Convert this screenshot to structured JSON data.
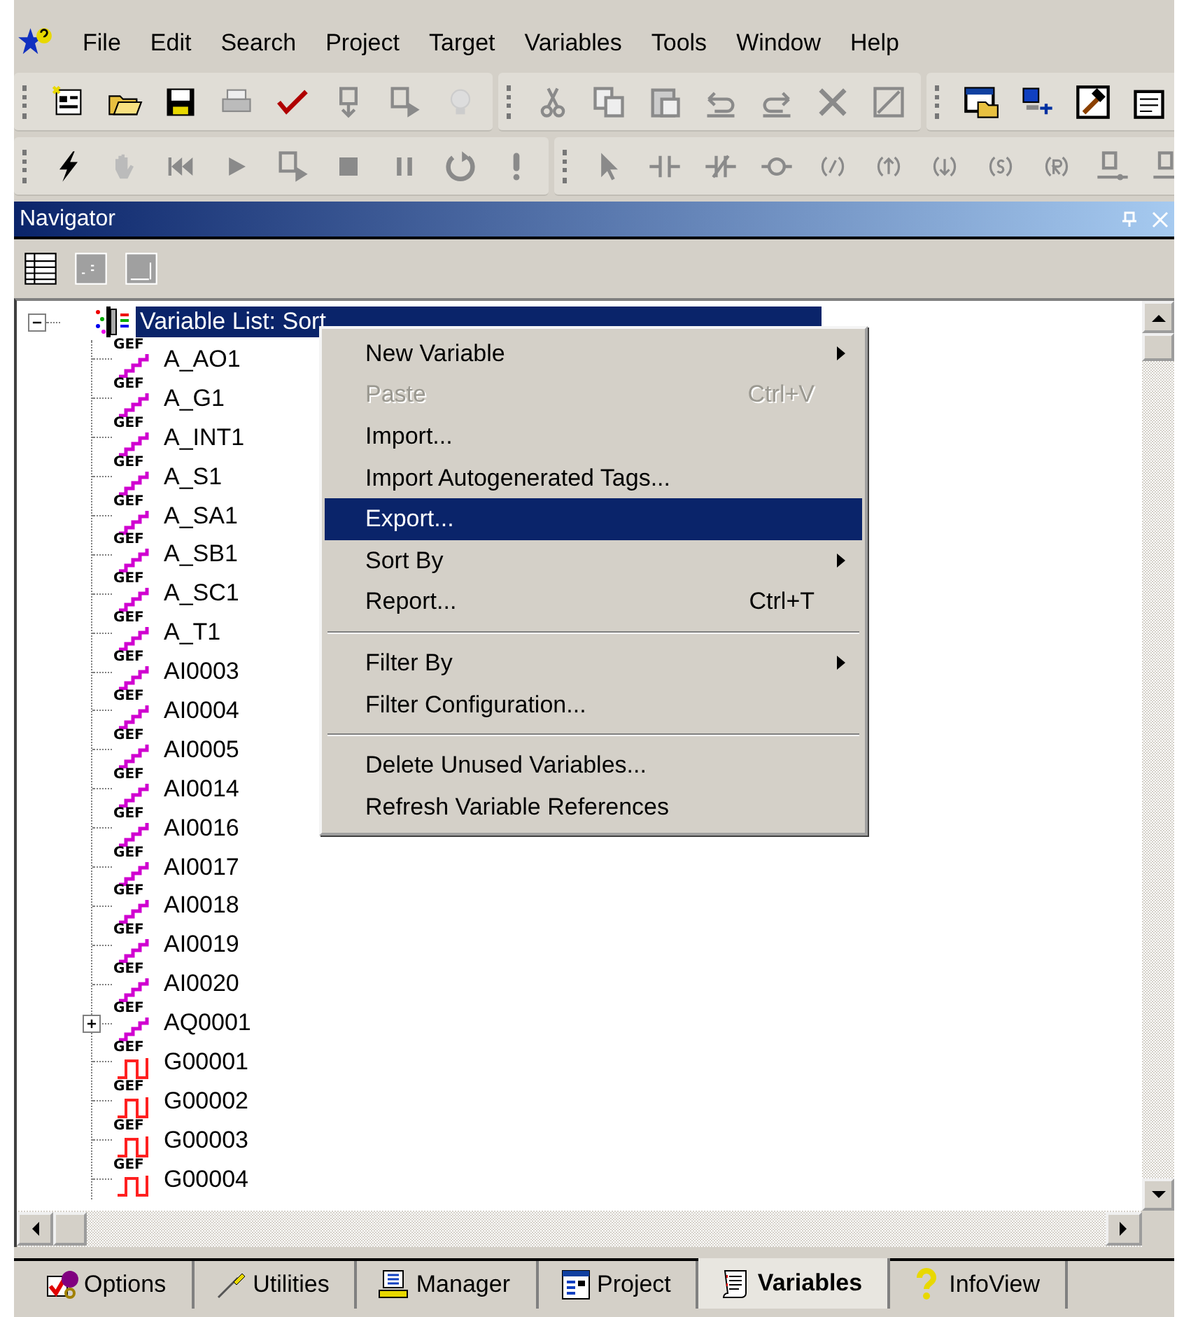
{
  "menubar": [
    "File",
    "Edit",
    "Search",
    "Project",
    "Target",
    "Variables",
    "Tools",
    "Window",
    "Help"
  ],
  "navigator": {
    "title": "Navigator",
    "tree": {
      "label": "Variable List: Sort",
      "expanded": true,
      "selected": true,
      "children": [
        {
          "label": "A_AO1",
          "kind": "analog",
          "icon_label": "GEF"
        },
        {
          "label": "A_G1",
          "kind": "analog",
          "icon_label": "GEF"
        },
        {
          "label": "A_INT1",
          "kind": "analog",
          "icon_label": "GEF"
        },
        {
          "label": "A_S1",
          "kind": "analog",
          "icon_label": "GEF"
        },
        {
          "label": "A_SA1",
          "kind": "analog",
          "icon_label": "GEF"
        },
        {
          "label": "A_SB1",
          "kind": "analog",
          "icon_label": "GEF"
        },
        {
          "label": "A_SC1",
          "kind": "analog",
          "icon_label": "GEF"
        },
        {
          "label": "A_T1",
          "kind": "analog",
          "icon_label": "GEF"
        },
        {
          "label": "AI0003",
          "kind": "analog",
          "icon_label": "GEF"
        },
        {
          "label": "AI0004",
          "kind": "analog",
          "icon_label": "GEF"
        },
        {
          "label": "AI0005",
          "kind": "analog",
          "icon_label": "GEF"
        },
        {
          "label": "AI0014",
          "kind": "analog",
          "icon_label": "GEF"
        },
        {
          "label": "AI0016",
          "kind": "analog",
          "icon_label": "GEF"
        },
        {
          "label": "AI0017",
          "kind": "analog",
          "icon_label": "GEF"
        },
        {
          "label": "AI0018",
          "kind": "analog",
          "icon_label": "GEF"
        },
        {
          "label": "AI0019",
          "kind": "analog",
          "icon_label": "GEF"
        },
        {
          "label": "AI0020",
          "kind": "analog",
          "icon_label": "GEF"
        },
        {
          "label": "AQ0001",
          "kind": "analog",
          "icon_label": "GEF",
          "expanded": false
        },
        {
          "label": "G00001",
          "kind": "discrete",
          "icon_label": "GEF"
        },
        {
          "label": "G00002",
          "kind": "discrete",
          "icon_label": "GEF"
        },
        {
          "label": "G00003",
          "kind": "discrete",
          "icon_label": "GEF"
        },
        {
          "label": "G00004",
          "kind": "discrete",
          "icon_label": "GEF"
        }
      ]
    }
  },
  "context_menu": {
    "items": [
      {
        "kind": "item",
        "label": "New Variable",
        "submenu": true,
        "disabled": false,
        "selected": false
      },
      {
        "kind": "item",
        "label": "Paste",
        "shortcut": "Ctrl+V",
        "submenu": false,
        "disabled": true,
        "selected": false
      },
      {
        "kind": "item",
        "label": "Import...",
        "submenu": false,
        "disabled": false,
        "selected": false
      },
      {
        "kind": "item",
        "label": "Import Autogenerated Tags...",
        "submenu": false,
        "disabled": false,
        "selected": false
      },
      {
        "kind": "item",
        "label": "Export...",
        "submenu": false,
        "disabled": false,
        "selected": true
      },
      {
        "kind": "item",
        "label": "Sort By",
        "submenu": true,
        "disabled": false,
        "selected": false
      },
      {
        "kind": "item",
        "label": "Report...",
        "shortcut": "Ctrl+T",
        "submenu": false,
        "disabled": false,
        "selected": false
      },
      {
        "kind": "separator"
      },
      {
        "kind": "item",
        "label": "Filter By",
        "submenu": true,
        "disabled": false,
        "selected": false
      },
      {
        "kind": "item",
        "label": "Filter Configuration...",
        "submenu": false,
        "disabled": false,
        "selected": false
      },
      {
        "kind": "separator"
      },
      {
        "kind": "item",
        "label": "Delete Unused Variables...",
        "submenu": false,
        "disabled": false,
        "selected": false
      },
      {
        "kind": "item",
        "label": "Refresh Variable References",
        "submenu": false,
        "disabled": false,
        "selected": false
      }
    ]
  },
  "tabs": [
    {
      "label": "Options",
      "selected": false
    },
    {
      "label": "Utilities",
      "selected": false
    },
    {
      "label": "Manager",
      "selected": false
    },
    {
      "label": "Project",
      "selected": false
    },
    {
      "label": "Variables",
      "selected": true
    },
    {
      "label": "InfoView",
      "selected": false
    }
  ]
}
